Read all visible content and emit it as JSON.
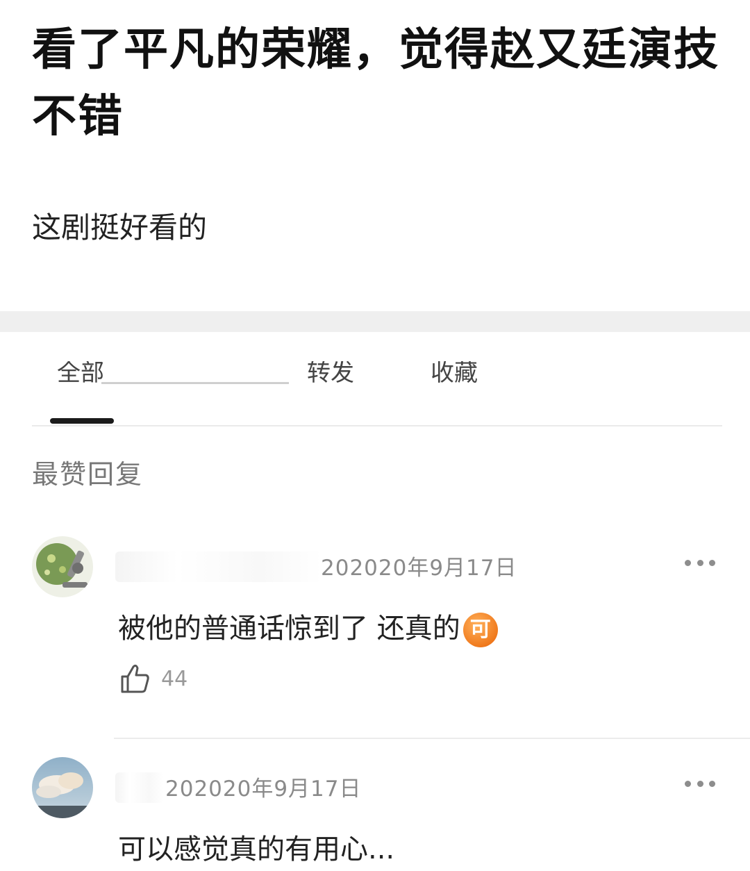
{
  "post": {
    "title": "看了平凡的荣耀，觉得赵又廷演技不错",
    "body": "这剧挺好看的"
  },
  "tabs": [
    {
      "label": "全部",
      "active": true
    },
    {
      "label": "转发",
      "active": false
    },
    {
      "label": "收藏",
      "active": false
    }
  ],
  "section_label": "最赞回复",
  "comments": [
    {
      "username_visible": "",
      "timestamp": "202020年9月17日",
      "text": "被他的普通话惊到了 还真的",
      "emoji": "可",
      "likes": "44"
    },
    {
      "username_visible": "",
      "timestamp": "202020年9月17日",
      "text": "可以感觉真的有用心..."
    }
  ],
  "colors": {
    "accent_underline": "#1b1b1b",
    "emoji_orange": "#f07a1d",
    "secondary_text": "#8a8a8a"
  },
  "icons": [
    "more-icon",
    "thumbs-up-icon"
  ]
}
